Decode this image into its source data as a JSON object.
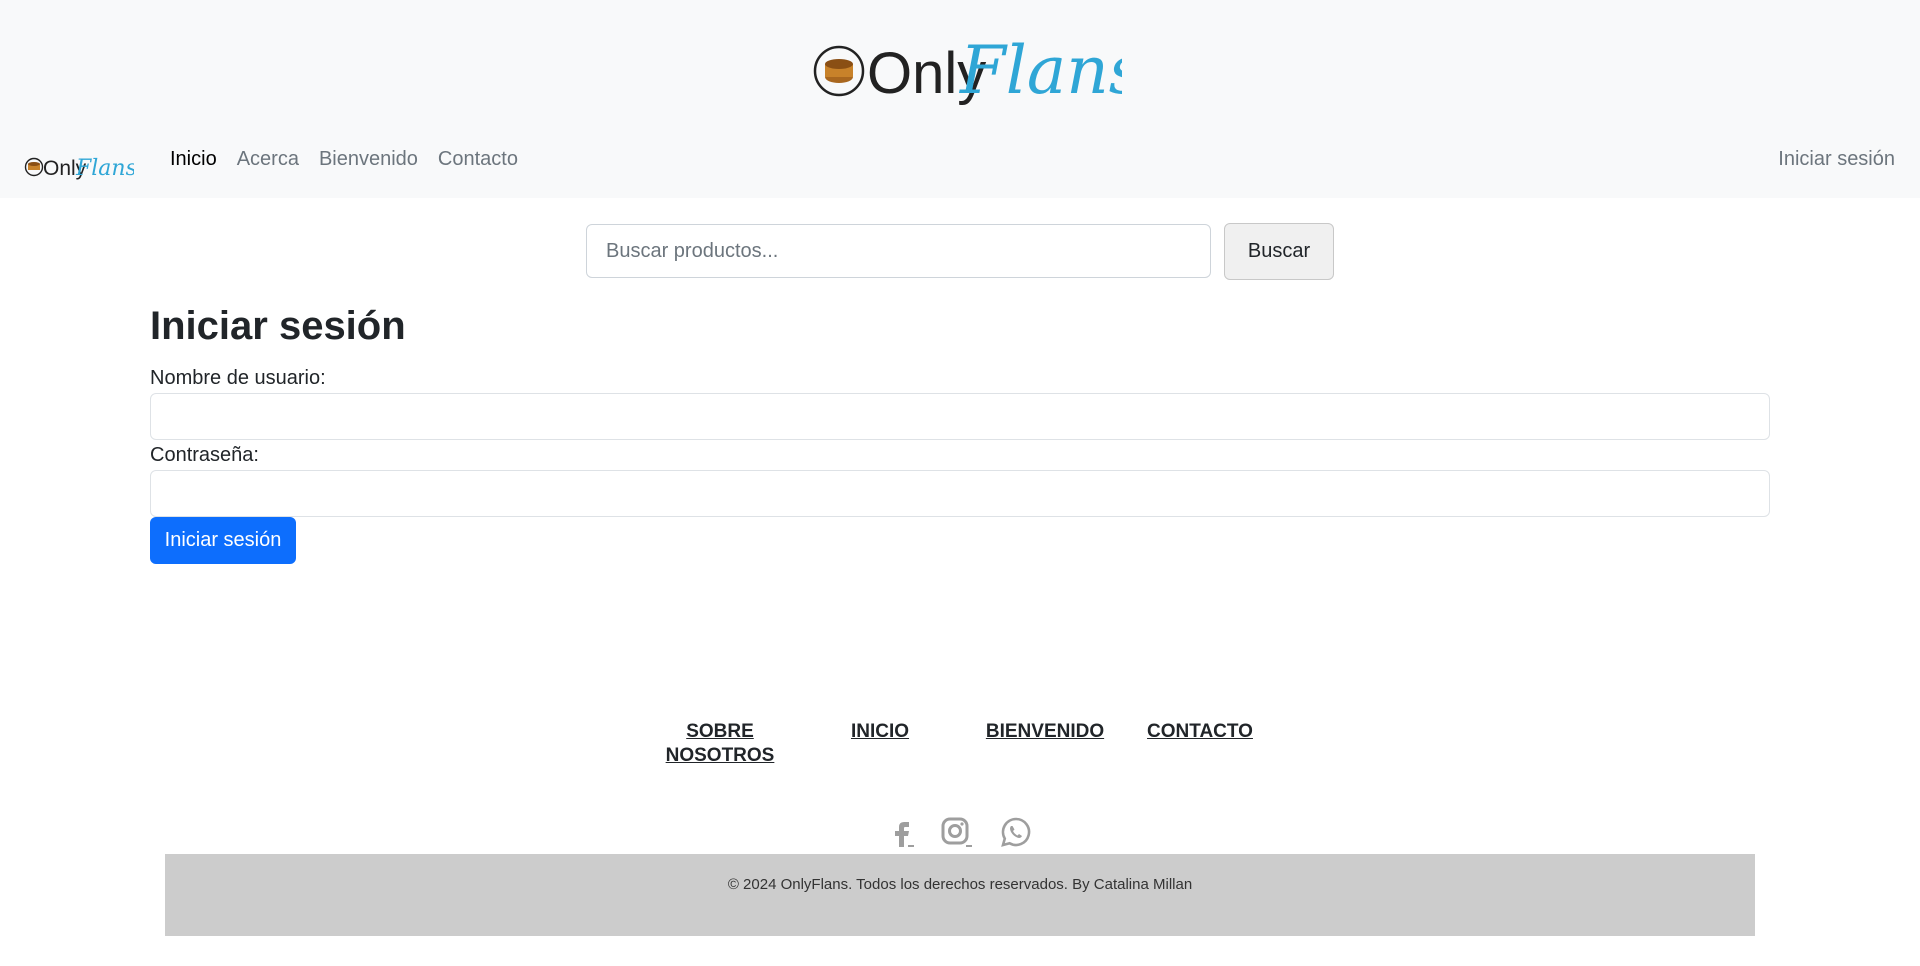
{
  "brand": {
    "logo_text_plain": "Only",
    "logo_text_script": "Flans",
    "logo_plain_color": "#222222",
    "logo_script_color": "#2fa6d6",
    "flan_color": "#c8822a"
  },
  "navbar": {
    "links": [
      {
        "label": "Inicio",
        "active": true
      },
      {
        "label": "Acerca",
        "active": false
      },
      {
        "label": "Bienvenido",
        "active": false
      },
      {
        "label": "Contacto",
        "active": false
      }
    ],
    "login_label": "Iniciar sesión"
  },
  "search": {
    "placeholder": "Buscar productos...",
    "value": "",
    "button_label": "Buscar"
  },
  "login_form": {
    "title": "Iniciar sesión",
    "username_label": "Nombre de usuario:",
    "username_value": "",
    "password_label": "Contraseña:",
    "password_value": "",
    "submit_label": "Iniciar sesión",
    "accent_color": "#0d6efd"
  },
  "footer": {
    "links": {
      "about_line1": "SOBRE",
      "about_line2": "NOSOTROS",
      "home": "INICIO",
      "welcome": "BIENVENIDO",
      "contact": "CONTACTO"
    },
    "social_icons": [
      "facebook-icon",
      "instagram-icon",
      "whatsapp-icon"
    ],
    "copyright": "© 2024 OnlyFlans. Todos los derechos reservados. By Catalina Millan",
    "copyright_bg": "#cccccc"
  }
}
